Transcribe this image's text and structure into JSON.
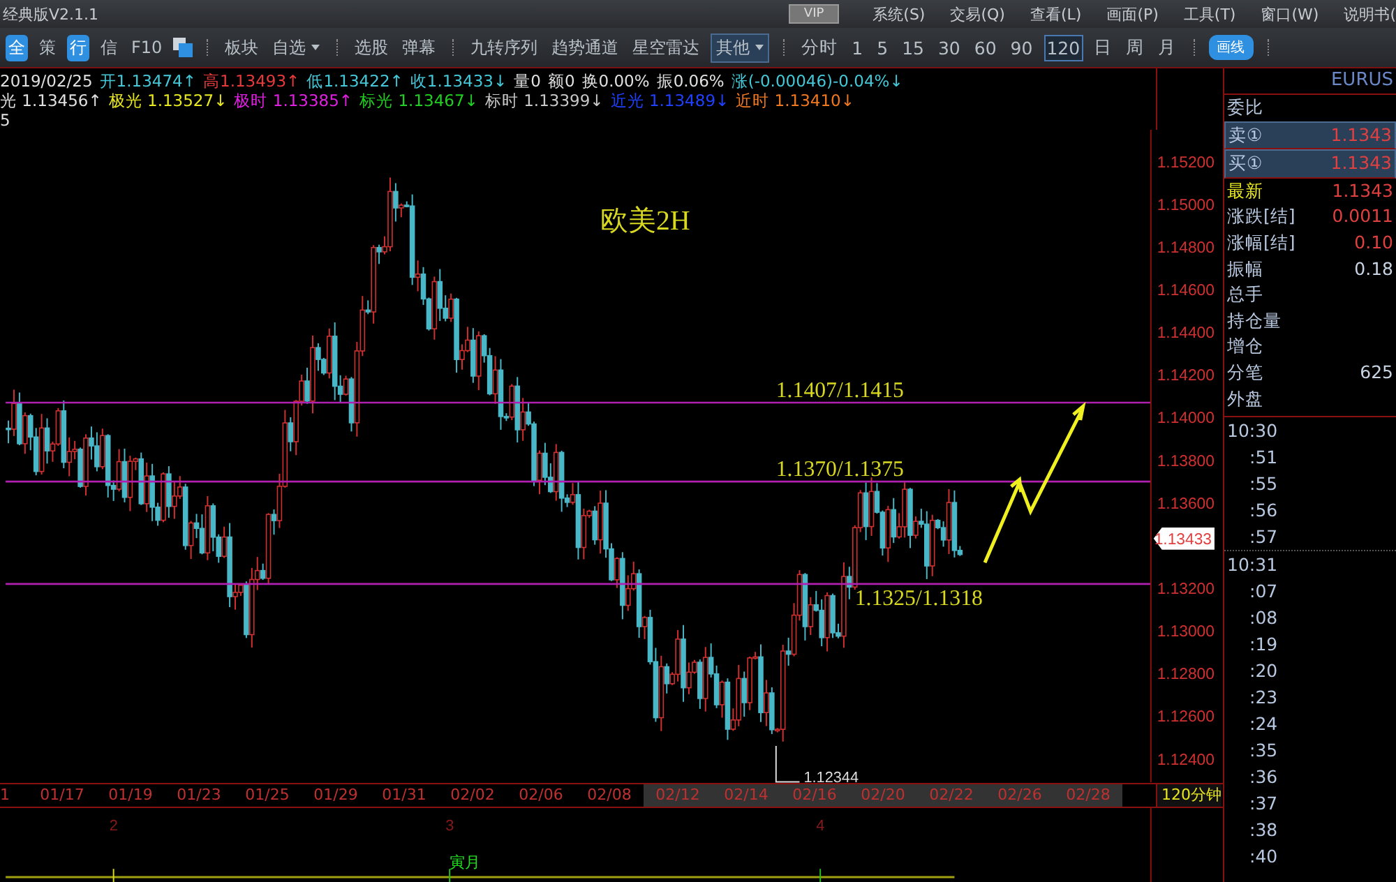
{
  "window": {
    "title": "经典版V2.1.1"
  },
  "menu": {
    "vip": "VIP",
    "items": [
      "系统(S)",
      "交易(Q)",
      "查看(L)",
      "画面(P)",
      "工具(T)",
      "窗口(W)",
      "说明书("
    ]
  },
  "toolbar": {
    "items": [
      {
        "kind": "chip",
        "label": "全"
      },
      {
        "kind": "plain",
        "label": "策"
      },
      {
        "kind": "chip",
        "label": "行"
      },
      {
        "kind": "plain",
        "label": "信"
      },
      {
        "kind": "plain",
        "label": "F10"
      },
      {
        "kind": "icon"
      },
      {
        "kind": "sep"
      },
      {
        "kind": "plain",
        "label": "板块"
      },
      {
        "kind": "dropdown",
        "label": "自选"
      },
      {
        "kind": "sep"
      },
      {
        "kind": "plain",
        "label": "选股"
      },
      {
        "kind": "plain",
        "label": "弹幕"
      },
      {
        "kind": "sep"
      },
      {
        "kind": "plain",
        "label": "九转序列"
      },
      {
        "kind": "plain",
        "label": "趋势通道"
      },
      {
        "kind": "plain",
        "label": "星空雷达"
      },
      {
        "kind": "dropdown-boxed",
        "label": "其他"
      },
      {
        "kind": "sep"
      }
    ],
    "periods": [
      {
        "label": "分时",
        "selected": false
      },
      {
        "label": "1",
        "selected": false
      },
      {
        "label": "5",
        "selected": false
      },
      {
        "label": "15",
        "selected": false
      },
      {
        "label": "30",
        "selected": false
      },
      {
        "label": "60",
        "selected": false
      },
      {
        "label": "90",
        "selected": false
      },
      {
        "label": "120",
        "selected": true
      },
      {
        "label": "日",
        "selected": false
      },
      {
        "label": "周",
        "selected": false
      },
      {
        "label": "月",
        "selected": false
      }
    ],
    "draw_button": "画线"
  },
  "quote_line": {
    "date": "2019/02/25",
    "items": [
      {
        "text": "开1.13474↑",
        "color": "#44c8d8"
      },
      {
        "text": "高1.13493↑",
        "color": "#e83a3a"
      },
      {
        "text": "低1.13422↑",
        "color": "#44c8d8"
      },
      {
        "text": "收1.13433↓",
        "color": "#44c8d8"
      },
      {
        "text": "量0",
        "color": "#e0e0e0"
      },
      {
        "text": "额0",
        "color": "#e0e0e0"
      },
      {
        "text": "换0.00%",
        "color": "#e0e0e0"
      },
      {
        "text": "振0.06%",
        "color": "#e0e0e0"
      },
      {
        "text": "涨(-0.00046)-0.04%↓",
        "color": "#44c8d8"
      }
    ]
  },
  "indicator_line": [
    {
      "text": "光 1.13456↑",
      "color": "#e0e0e0"
    },
    {
      "text": "极光 1.13527↓",
      "color": "#e8e820"
    },
    {
      "text": "极时 1.13385↑",
      "color": "#e020e0"
    },
    {
      "text": "标光 1.13467↓",
      "color": "#20d020"
    },
    {
      "text": "标时 1.13399↓",
      "color": "#c8c8c8"
    },
    {
      "text": "近光 1.13489↓",
      "color": "#2040ff"
    },
    {
      "text": "近时 1.13410↓",
      "color": "#f07820"
    }
  ],
  "indicator_third_line": "5",
  "chart": {
    "title": "欧美2H",
    "levels": [
      {
        "label": "1.1407/1.1415"
      },
      {
        "label": "1.1370/1.1375"
      },
      {
        "label": "1.1325/1.1318"
      }
    ],
    "low_marker": "1.12344",
    "current_price": "1.13433",
    "price_ticks": [
      "1.15200",
      "1.15000",
      "1.14800",
      "1.14600",
      "1.14400",
      "1.14200",
      "1.14000",
      "1.13800",
      "1.13600",
      "1.13200",
      "1.13000",
      "1.12800",
      "1.12600",
      "1.12400"
    ],
    "period_label": "120分钟"
  },
  "date_axis": [
    {
      "label": "1",
      "in_range": false
    },
    {
      "label": "01/17",
      "in_range": false
    },
    {
      "label": "01/19",
      "in_range": false
    },
    {
      "label": "01/23",
      "in_range": false
    },
    {
      "label": "01/25",
      "in_range": false
    },
    {
      "label": "01/29",
      "in_range": false
    },
    {
      "label": "01/31",
      "in_range": false
    },
    {
      "label": "02/02",
      "in_range": false
    },
    {
      "label": "02/06",
      "in_range": false
    },
    {
      "label": "02/08",
      "in_range": false
    },
    {
      "label": "02/12",
      "in_range": true
    },
    {
      "label": "02/14",
      "in_range": true
    },
    {
      "label": "02/16",
      "in_range": true
    },
    {
      "label": "02/20",
      "in_range": true
    },
    {
      "label": "02/22",
      "in_range": true
    },
    {
      "label": "02/26",
      "in_range": true
    },
    {
      "label": "02/28",
      "in_range": true
    }
  ],
  "lower_panel": {
    "markers": [
      "2",
      "3",
      "4"
    ],
    "month_label": "寅月"
  },
  "quote_panel": {
    "symbol": "EURUS",
    "rows": [
      {
        "label": "委比",
        "value": "",
        "highlight": false
      },
      {
        "label": "卖①",
        "value": "1.1343",
        "highlight": false
      },
      {
        "label": "买①",
        "value": "1.1343",
        "highlight": false
      },
      {
        "label": "最新",
        "value": "1.1343",
        "highlight": true
      },
      {
        "label": "涨跌[结]",
        "value": "0.0011",
        "highlight": false
      },
      {
        "label": "涨幅[结]",
        "value": "0.10",
        "highlight": false
      },
      {
        "label": "振幅",
        "value": "0.18",
        "highlight": false
      },
      {
        "label": "总手",
        "value": "",
        "highlight": false
      },
      {
        "label": "持仓量",
        "value": "",
        "highlight": false
      },
      {
        "label": "增仓",
        "value": "",
        "highlight": false
      },
      {
        "label": "分笔",
        "value": "625",
        "highlight": false
      },
      {
        "label": "外盘",
        "value": "",
        "highlight": false
      }
    ],
    "ticks": [
      {
        "time": "10:30",
        "hour": true
      },
      {
        "time": ":51",
        "hour": false
      },
      {
        "time": ":55",
        "hour": false
      },
      {
        "time": ":56",
        "hour": false
      },
      {
        "time": ":57",
        "hour": false
      },
      {
        "time": "10:31",
        "hour": true
      },
      {
        "time": ":07",
        "hour": false
      },
      {
        "time": ":08",
        "hour": false
      },
      {
        "time": ":19",
        "hour": false
      },
      {
        "time": ":20",
        "hour": false
      },
      {
        "time": ":23",
        "hour": false
      },
      {
        "time": ":24",
        "hour": false
      },
      {
        "time": ":35",
        "hour": false
      },
      {
        "time": ":36",
        "hour": false
      },
      {
        "time": ":37",
        "hour": false
      },
      {
        "time": ":38",
        "hour": false
      },
      {
        "time": ":40",
        "hour": false
      }
    ]
  }
}
